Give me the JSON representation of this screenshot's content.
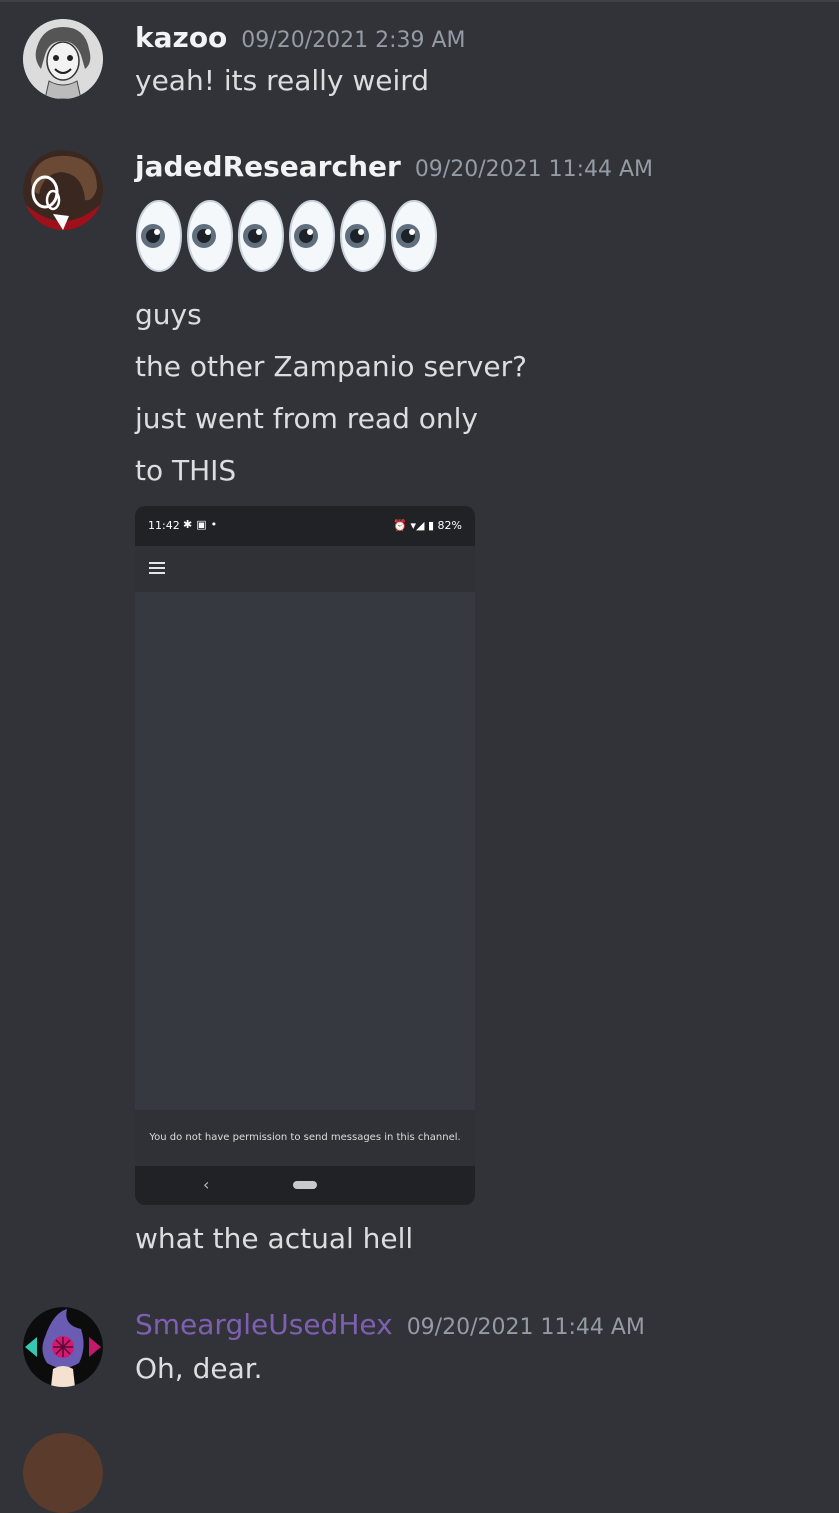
{
  "messages": [
    {
      "username": "kazoo",
      "timestamp": "09/20/2021 2:39 AM",
      "lines": [
        "yeah! its really weird"
      ]
    },
    {
      "username": "jadedResearcher",
      "timestamp": "09/20/2021 11:44 AM",
      "emoji": [
        "eyes",
        "eyes",
        "eyes",
        "eyes",
        "eyes",
        "eyes"
      ],
      "lines": [
        "guys",
        "the other Zampanio server?",
        "just went from read only",
        "to THIS"
      ],
      "attachment": {
        "status_time": "11:42",
        "status_battery": "82%",
        "permission_text": "You do not have permission to send messages in this channel.",
        "nav_back": "‹"
      },
      "after_lines": [
        "what the actual hell"
      ]
    },
    {
      "username": "SmeargleUsedHex",
      "username_color": "#7e5fb2",
      "timestamp": "09/20/2021 11:44 AM",
      "lines": [
        "Oh, dear."
      ]
    }
  ],
  "colors": {
    "background": "#313338",
    "text": "#dbdee1",
    "timestamp": "#949ba4"
  }
}
